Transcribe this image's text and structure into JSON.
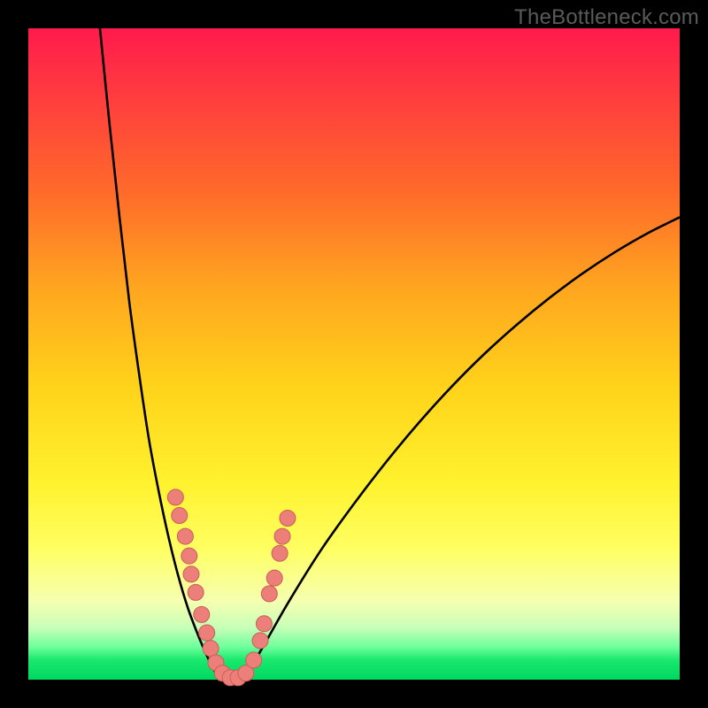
{
  "watermark": "TheBottleneck.com",
  "colors": {
    "frame": "#000000",
    "curve": "#000000",
    "marker_fill": "#ed7f7a",
    "marker_stroke": "#c95e57"
  },
  "chart_data": {
    "type": "line",
    "title": "",
    "xlabel": "",
    "ylabel": "",
    "xlim": [
      0,
      100
    ],
    "ylim": [
      0,
      100
    ],
    "series": [
      {
        "name": "bottleneck-curve-left",
        "x": [
          11.0,
          12.5,
          14.0,
          15.5,
          17.0,
          18.5,
          20.0,
          21.5,
          23.0,
          24.5,
          26.0,
          27.5,
          28.8
        ],
        "values": [
          100.0,
          85.0,
          71.0,
          58.0,
          47.0,
          37.0,
          29.0,
          22.0,
          16.0,
          11.0,
          7.0,
          3.5,
          1.0
        ]
      },
      {
        "name": "bottleneck-curve-bottom",
        "x": [
          28.8,
          30.0,
          31.2,
          32.4,
          33.6
        ],
        "values": [
          1.0,
          0.0,
          0.0,
          0.0,
          1.0
        ]
      },
      {
        "name": "bottleneck-curve-right",
        "x": [
          33.6,
          36.0,
          40.0,
          45.0,
          50.0,
          55.0,
          60.0,
          65.0,
          70.0,
          75.0,
          80.0,
          85.0,
          90.0,
          95.0,
          100.0
        ],
        "values": [
          1.0,
          5.0,
          12.0,
          20.0,
          27.0,
          33.5,
          39.5,
          45.0,
          50.0,
          54.5,
          58.6,
          62.3,
          65.6,
          68.5,
          71.0
        ]
      }
    ],
    "markers": {
      "name": "sample-points",
      "points": [
        {
          "x": 22.6,
          "y": 28.0
        },
        {
          "x": 23.2,
          "y": 25.2
        },
        {
          "x": 24.1,
          "y": 22.0
        },
        {
          "x": 24.7,
          "y": 19.0
        },
        {
          "x": 25.0,
          "y": 16.2
        },
        {
          "x": 25.7,
          "y": 13.4
        },
        {
          "x": 26.6,
          "y": 10.0
        },
        {
          "x": 27.4,
          "y": 7.2
        },
        {
          "x": 28.0,
          "y": 4.8
        },
        {
          "x": 28.8,
          "y": 2.6
        },
        {
          "x": 29.8,
          "y": 1.0
        },
        {
          "x": 31.0,
          "y": 0.3
        },
        {
          "x": 32.2,
          "y": 0.3
        },
        {
          "x": 33.4,
          "y": 1.0
        },
        {
          "x": 34.6,
          "y": 3.0
        },
        {
          "x": 35.6,
          "y": 6.0
        },
        {
          "x": 36.2,
          "y": 8.6
        },
        {
          "x": 37.0,
          "y": 13.2
        },
        {
          "x": 37.8,
          "y": 15.6
        },
        {
          "x": 38.6,
          "y": 19.4
        },
        {
          "x": 39.0,
          "y": 22.0
        },
        {
          "x": 39.8,
          "y": 24.8
        }
      ]
    }
  }
}
